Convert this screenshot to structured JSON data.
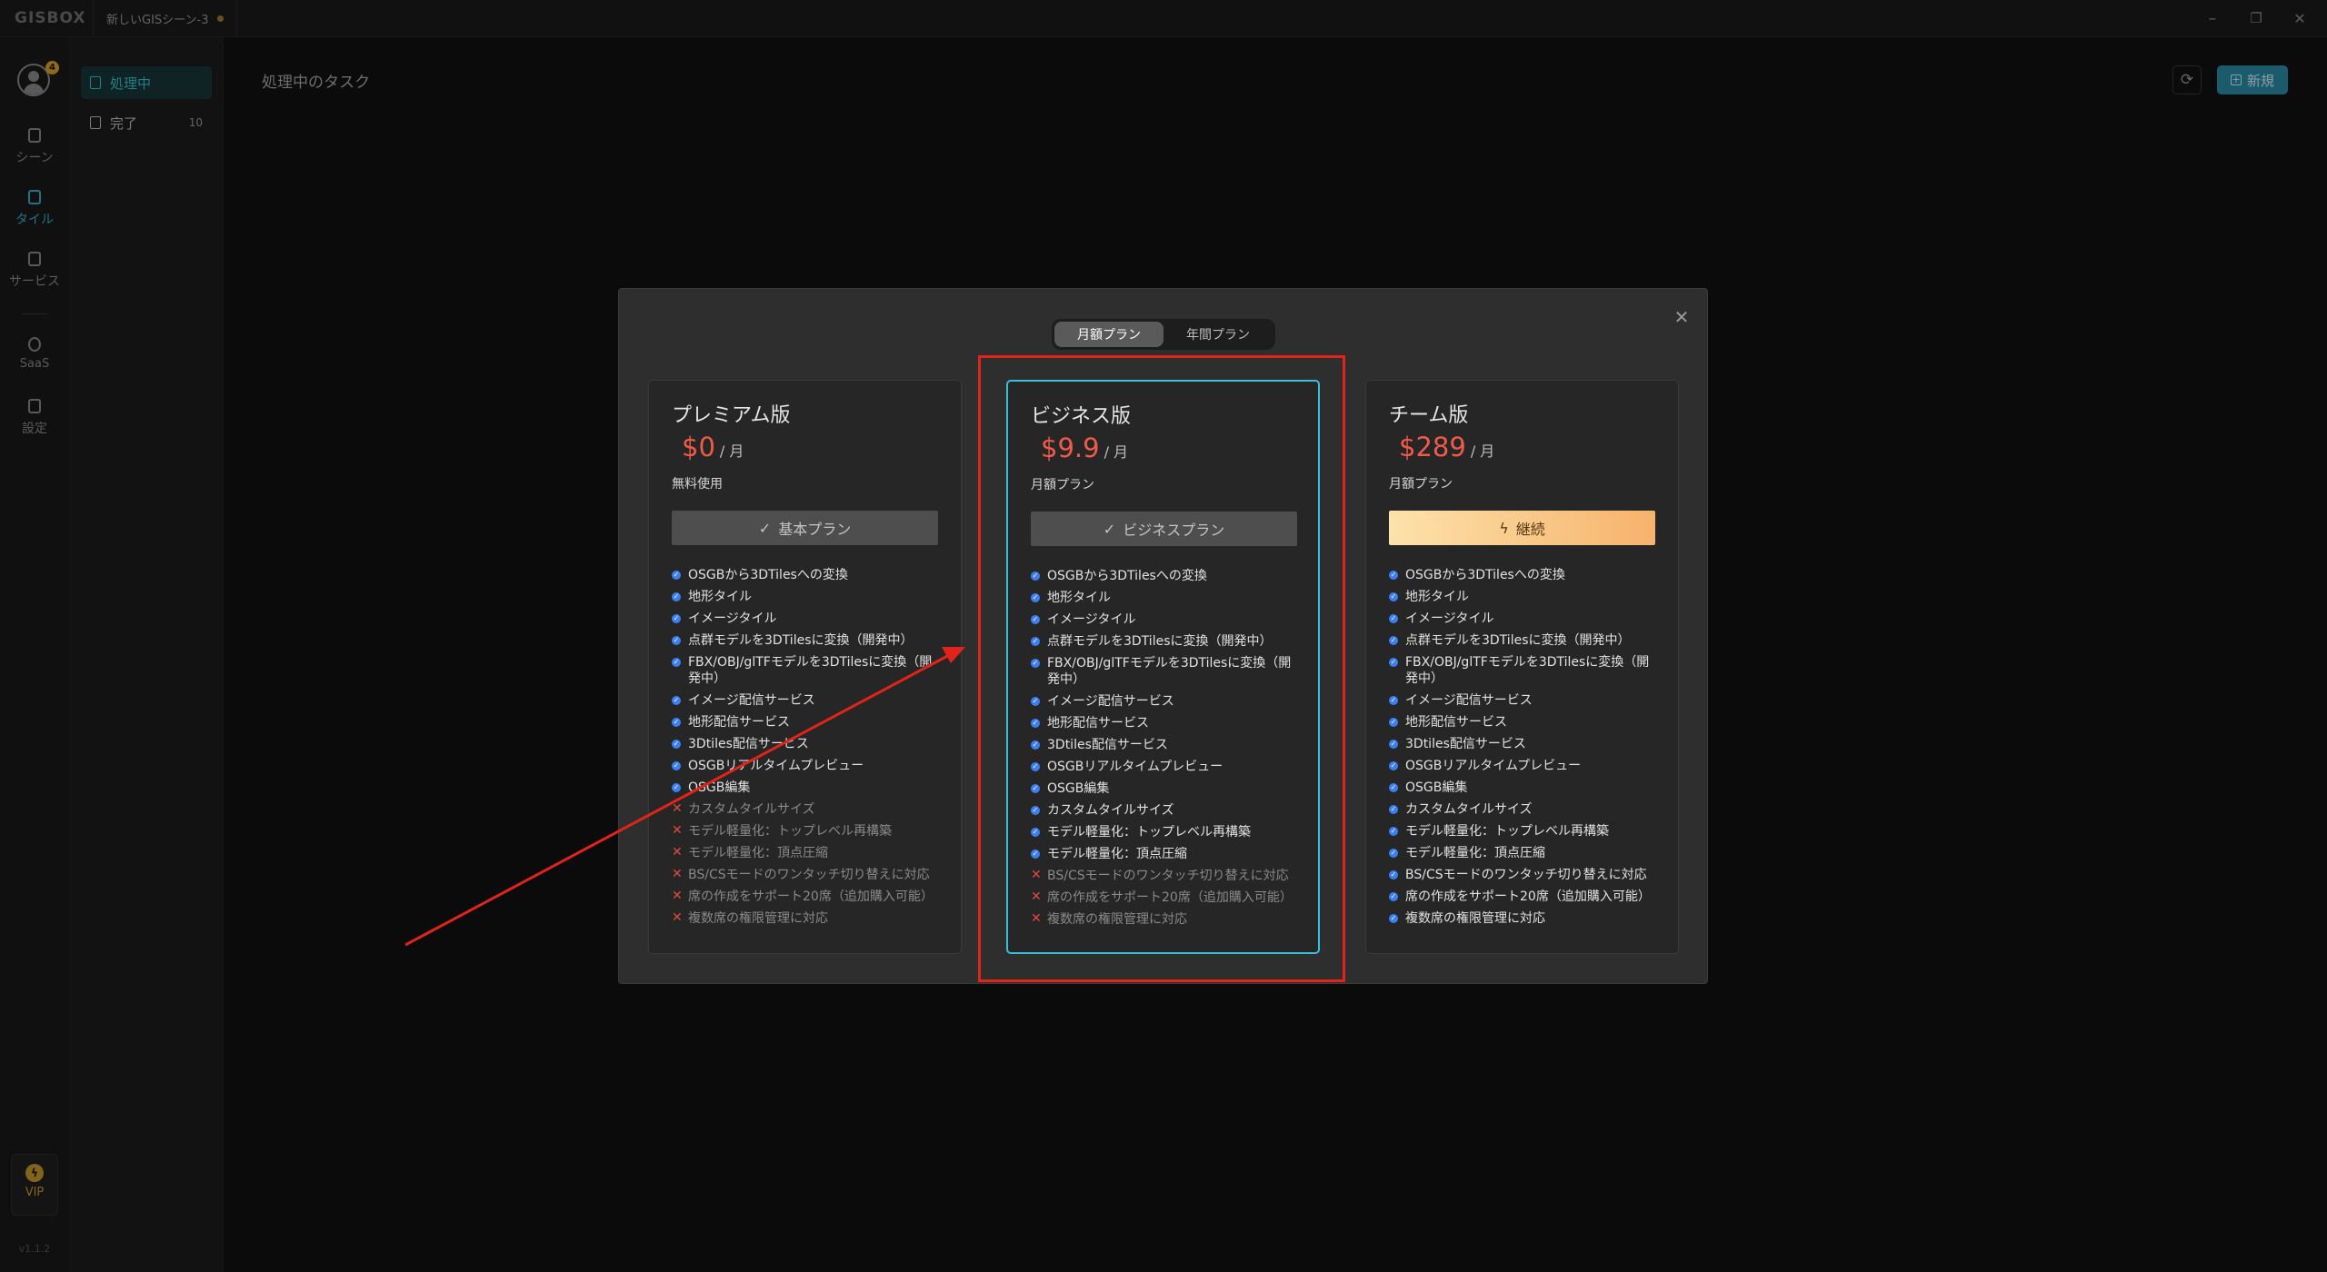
{
  "window": {
    "logo": "GISBOX",
    "doc_tab": "新しいGISシーン-3",
    "controls": [
      "–",
      "❐",
      "✕"
    ]
  },
  "rail": {
    "badge": "4",
    "items": [
      {
        "label": "シーン",
        "icon": "scene-icon"
      },
      {
        "label": "タイル",
        "icon": "tile-icon"
      },
      {
        "label": "サービス",
        "icon": "service-icon"
      },
      {
        "label": "SaaS",
        "icon": "saas-icon"
      },
      {
        "label": "設定",
        "icon": "settings-icon"
      }
    ],
    "vip": "VIP",
    "version": "v1.1.2"
  },
  "tasks": {
    "items": [
      {
        "label": "処理中"
      },
      {
        "label": "完了",
        "count": "10"
      }
    ]
  },
  "main": {
    "title": "処理中のタスク",
    "new_label": "新規"
  },
  "modal": {
    "toggle": [
      "月額プラン",
      "年間プラン"
    ],
    "plans": [
      {
        "title": "プレミアム版",
        "currency": "$",
        "price": "0",
        "unit": "/ 月",
        "subtitle": "無料使用",
        "button": "基本プラン",
        "features": [
          "OSGBから3DTilesへの変換",
          "地形タイル",
          "イメージタイル",
          "点群モデルを3DTilesに変換（開発中）",
          "FBX/OBJ/glTFモデルを3DTilesに変換（開発中）",
          "イメージ配信サービス",
          "地形配信サービス",
          "3Dtiles配信サービス",
          "OSGBリアルタイムプレビュー",
          "OSGB編集",
          "カスタムタイルサイズ",
          "モデル軽量化：トップレベル再構築",
          "モデル軽量化：頂点圧縮",
          "BS/CSモードのワンタッチ切り替えに対応",
          "席の作成をサポート20席（追加購入可能）",
          "複数席の権限管理に対応"
        ]
      },
      {
        "title": "ビジネス版",
        "currency": "$",
        "price": "9.9",
        "unit": "/ 月",
        "subtitle": "月額プラン",
        "button": "ビジネスプラン",
        "features": [
          "OSGBから3DTilesへの変換",
          "地形タイル",
          "イメージタイル",
          "点群モデルを3DTilesに変換（開発中）",
          "FBX/OBJ/glTFモデルを3DTilesに変換（開発中）",
          "イメージ配信サービス",
          "地形配信サービス",
          "3Dtiles配信サービス",
          "OSGBリアルタイムプレビュー",
          "OSGB編集",
          "カスタムタイルサイズ",
          "モデル軽量化：トップレベル再構築",
          "モデル軽量化：頂点圧縮",
          "BS/CSモードのワンタッチ切り替えに対応",
          "席の作成をサポート20席（追加購入可能）",
          "複数席の権限管理に対応"
        ]
      },
      {
        "title": "チーム版",
        "currency": "$",
        "price": "289",
        "unit": "/ 月",
        "subtitle": "月額プラン",
        "button": "継続",
        "features": [
          "OSGBから3DTilesへの変換",
          "地形タイル",
          "イメージタイル",
          "点群モデルを3DTilesに変換（開発中）",
          "FBX/OBJ/glTFモデルを3DTilesに変換（開発中）",
          "イメージ配信サービス",
          "地形配信サービス",
          "3Dtiles配信サービス",
          "OSGBリアルタイムプレビュー",
          "OSGB編集",
          "カスタムタイルサイズ",
          "モデル軽量化：トップレベル再構築",
          "モデル軽量化：頂点圧縮",
          "BS/CSモードのワンタッチ切り替えに対応",
          "席の作成をサポート20席（追加購入可能）",
          "複数席の権限管理に対応"
        ]
      }
    ]
  },
  "colors": {
    "accent": "#2fb3c9",
    "price": "#f05a4a",
    "annotation": "#e0241b"
  }
}
